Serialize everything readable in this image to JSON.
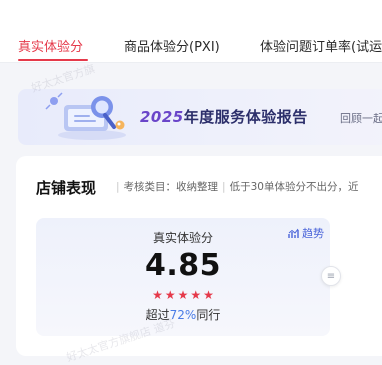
{
  "tabs": [
    {
      "label": "真实体验分",
      "active": true
    },
    {
      "label": "商品体验分(PXI)",
      "active": false
    },
    {
      "label": "体验问题订单率(试运",
      "active": false
    }
  ],
  "banner": {
    "title_year": "2025",
    "title_rest": "年度服务体验报告",
    "subtitle": "回顾一起"
  },
  "store_section": {
    "title": "店铺表现",
    "category_label": "考核类目：收纳整理",
    "rule_note": "低于30单体验分不出分，近"
  },
  "score_card": {
    "label": "真实体验分",
    "value": "4.85",
    "trend_label": "趋势",
    "stars": 5,
    "compare_prefix": "超过",
    "compare_percent": "72%",
    "compare_suffix": "同行"
  },
  "watermark": {
    "top": "好太太官方旗",
    "bottom": "好太太官方旗舰店 道芬"
  },
  "colors": {
    "accent_red": "#e5394a",
    "accent_blue": "#4a64d9",
    "percent_blue": "#4a7ce6"
  }
}
